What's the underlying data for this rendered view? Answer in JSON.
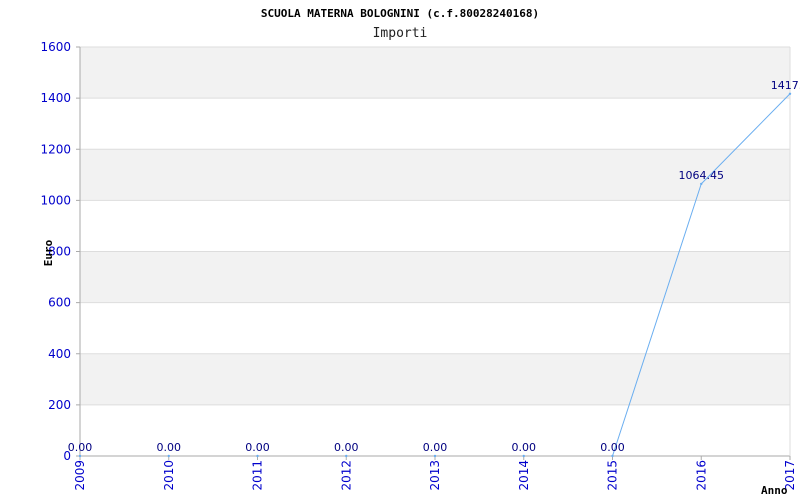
{
  "chart_data": {
    "type": "line",
    "title": "SCUOLA MATERNA BOLOGNINI (c.f.80028240168)",
    "subtitle": "Importi",
    "xlabel": "Anno",
    "ylabel": "Euro",
    "categories": [
      "2009",
      "2010",
      "2011",
      "2012",
      "2013",
      "2014",
      "2015",
      "2016",
      "2017"
    ],
    "series": [
      {
        "values": [
          0,
          0,
          0,
          0,
          0,
          0,
          0,
          1064.45,
          1417.0
        ],
        "data_labels": [
          "0.00",
          "0.00",
          "0.00",
          "0.00",
          "0.00",
          "0.00",
          "0.00",
          "1064.45",
          "1417.0"
        ],
        "color": "#6aaef0"
      }
    ],
    "ylim": [
      0,
      1600
    ],
    "y_ticks": [
      0,
      200,
      400,
      600,
      800,
      1000,
      1200,
      1400,
      1600
    ],
    "grid": true,
    "band_colors": [
      "#f2f2f2",
      "#ffffff"
    ],
    "tick_color": "#0000cc",
    "data_label_color": "#000080"
  }
}
